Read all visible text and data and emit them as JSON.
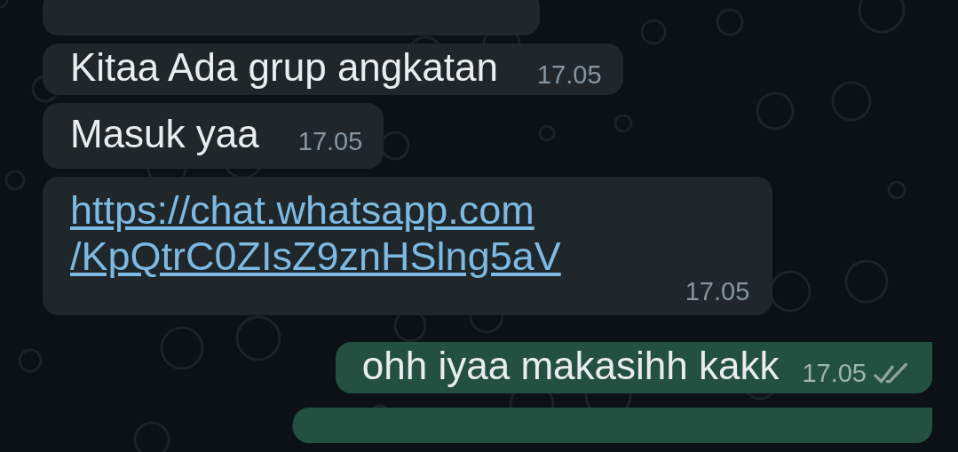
{
  "messages": [
    {
      "kind": "text",
      "outgoing": false,
      "text": "Kitaa Ada grup angkatan",
      "time": "17.05"
    },
    {
      "kind": "text",
      "outgoing": false,
      "text": "Masuk yaa",
      "time": "17.05"
    },
    {
      "kind": "link",
      "outgoing": false,
      "lines": [
        "https://chat.whatsapp.com",
        "/KpQtrC0ZIsZ9znHSlng5aV"
      ],
      "time": "17.05"
    },
    {
      "kind": "text",
      "outgoing": true,
      "text": "ohh iyaa makasihh kakk",
      "time": "17.05",
      "read": false
    }
  ]
}
